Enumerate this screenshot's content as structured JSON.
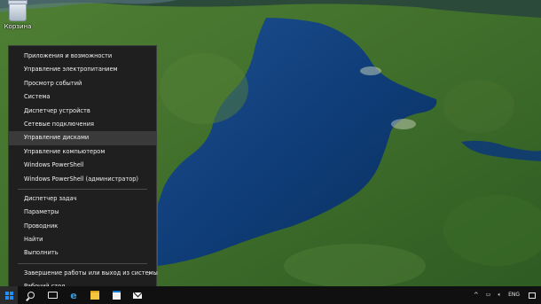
{
  "desktop": {
    "recycle_bin_label": "Корзина"
  },
  "winx_menu": {
    "groups": [
      [
        {
          "label": "Приложения и возможности"
        },
        {
          "label": "Управление электропитанием"
        },
        {
          "label": "Просмотр событий"
        },
        {
          "label": "Система"
        },
        {
          "label": "Диспетчер устройств"
        },
        {
          "label": "Сетевые подключения"
        },
        {
          "label": "Управление дисками",
          "highlighted": true
        },
        {
          "label": "Управление компьютером"
        },
        {
          "label": "Windows PowerShell"
        },
        {
          "label": "Windows PowerShell (администратор)"
        }
      ],
      [
        {
          "label": "Диспетчер задач"
        },
        {
          "label": "Параметры"
        },
        {
          "label": "Проводник"
        },
        {
          "label": "Найти"
        },
        {
          "label": "Выполнить"
        }
      ],
      [
        {
          "label": "Завершение работы или выход из системы",
          "submenu": true
        },
        {
          "label": "Рабочий стол"
        }
      ]
    ],
    "submenu_arrow": "›"
  },
  "taskbar": {
    "icons": [
      "windows-start-icon",
      "search-icon",
      "task-view-icon",
      "edge-icon",
      "file-explorer-icon",
      "store-icon",
      "mail-icon"
    ],
    "tray": {
      "chevron": "^",
      "language": "ENG"
    }
  }
}
